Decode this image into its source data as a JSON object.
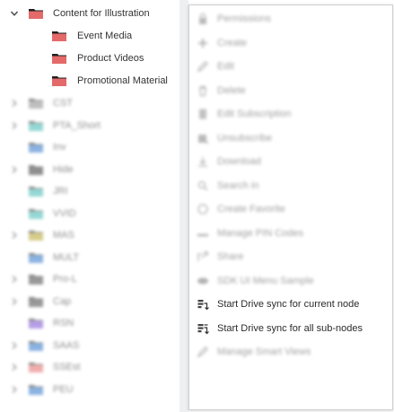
{
  "tree": {
    "root": {
      "label": "Content for Illustration",
      "color": "#e46a6a"
    },
    "children": [
      {
        "label": "Event Media",
        "color": "#e46a6a"
      },
      {
        "label": "Product Videos",
        "color": "#e46a6a"
      },
      {
        "label": "Promotional Material",
        "color": "#e46a6a"
      }
    ],
    "blurred_items": [
      {
        "label": "CST",
        "color": "#8a8a8a",
        "chevron": true
      },
      {
        "label": "PTA_Short",
        "color": "#3fb8b0",
        "chevron": true
      },
      {
        "label": "Inv",
        "color": "#2e74c9",
        "chevron": false
      },
      {
        "label": "Hide",
        "color": "#333333",
        "chevron": true
      },
      {
        "label": "JRI",
        "color": "#3fb8b0",
        "chevron": false
      },
      {
        "label": "VVID",
        "color": "#3fb8b0",
        "chevron": false
      },
      {
        "label": "MAS",
        "color": "#b5a22a",
        "chevron": true
      },
      {
        "label": "MULT",
        "color": "#2e74c9",
        "chevron": false
      },
      {
        "label": "Pro-L",
        "color": "#444444",
        "chevron": true
      },
      {
        "label": "Cap",
        "color": "#444444",
        "chevron": true
      },
      {
        "label": "RSN",
        "color": "#7a4fd0",
        "chevron": false
      },
      {
        "label": "SAAS",
        "color": "#2e74c9",
        "chevron": true
      },
      {
        "label": "SSEst",
        "color": "#e46a6a",
        "chevron": true
      },
      {
        "label": "PEU",
        "color": "#2e74c9",
        "chevron": true
      }
    ]
  },
  "context_menu": {
    "items": [
      {
        "label": "Permissions",
        "icon": "lock-icon",
        "enabled": false
      },
      {
        "label": "Create",
        "icon": "plus-icon",
        "enabled": false
      },
      {
        "label": "Edit",
        "icon": "pencil-icon",
        "enabled": false
      },
      {
        "label": "Delete",
        "icon": "trash-icon",
        "enabled": false
      },
      {
        "label": "Edit Subscription",
        "icon": "document-icon",
        "enabled": false
      },
      {
        "label": "Unsubscribe",
        "icon": "unsubscribe-icon",
        "enabled": false
      },
      {
        "label": "Download",
        "icon": "download-icon",
        "enabled": false
      },
      {
        "label": "Search in",
        "icon": "search-icon",
        "enabled": false
      },
      {
        "label": "Create Favorite",
        "icon": "star-icon",
        "enabled": false
      },
      {
        "label": "Manage PIN Codes",
        "icon": "key-icon",
        "enabled": false
      },
      {
        "label": "Share",
        "icon": "share-icon",
        "enabled": false
      },
      {
        "label": "SDK UI Menu Sample",
        "icon": "eye-icon",
        "enabled": false
      },
      {
        "label": "Start Drive sync for current node",
        "icon": "drive-sync-icon",
        "enabled": true
      },
      {
        "label": "Start Drive sync for all sub-nodes",
        "icon": "drive-sync-all-icon",
        "enabled": true
      },
      {
        "label": "Manage Smart Views",
        "icon": "smart-view-icon",
        "enabled": false
      }
    ]
  }
}
